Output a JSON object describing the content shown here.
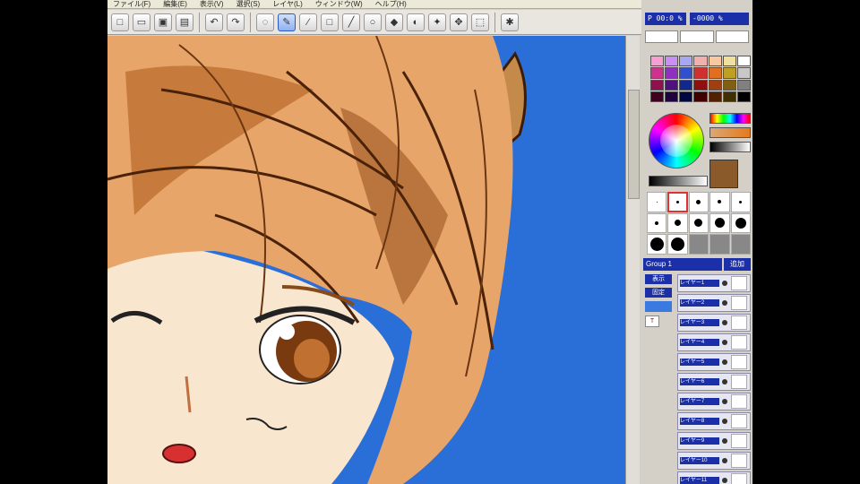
{
  "menubar": {
    "items": [
      "ファイル(F)",
      "編集(E)",
      "表示(V)",
      "選択(S)",
      "レイヤ(L)",
      "ウィンドウ(W)",
      "ヘルプ(H)"
    ]
  },
  "toolbar": {
    "tools": [
      {
        "name": "new-file-icon",
        "glyph": "□"
      },
      {
        "name": "open-folder-icon",
        "glyph": "▭"
      },
      {
        "name": "save-icon",
        "glyph": "▣"
      },
      {
        "name": "print-icon",
        "glyph": "▤"
      },
      {
        "name": "undo-icon",
        "glyph": "↶"
      },
      {
        "name": "redo-icon",
        "glyph": "↷"
      },
      {
        "name": "lasso-icon",
        "glyph": "◌"
      },
      {
        "name": "pen-icon",
        "glyph": "✎"
      },
      {
        "name": "eyedropper-icon",
        "glyph": "⁄"
      },
      {
        "name": "rectangle-icon",
        "glyph": "□"
      },
      {
        "name": "line-icon",
        "glyph": "╱"
      },
      {
        "name": "ellipse-icon",
        "glyph": "○"
      },
      {
        "name": "bucket-icon",
        "glyph": "◆"
      },
      {
        "name": "gradient-icon",
        "glyph": "◐"
      },
      {
        "name": "magic-wand-icon",
        "glyph": "✦"
      },
      {
        "name": "move-icon",
        "glyph": "✥"
      },
      {
        "name": "transform-icon",
        "glyph": "⬚"
      },
      {
        "name": "settings-icon",
        "glyph": "✱"
      }
    ]
  },
  "status": {
    "zoom": "P 00:0 %",
    "angle": "-0000 %"
  },
  "palette": {
    "colors": [
      "#f4a0d0",
      "#c890f0",
      "#a8a8f0",
      "#f0b0b0",
      "#f8c8a0",
      "#f0e0a0",
      "#ffffff",
      "#d03090",
      "#9030c0",
      "#3050d0",
      "#d03030",
      "#e07020",
      "#c0a020",
      "#c8c8c8",
      "#901050",
      "#501080",
      "#102890",
      "#901010",
      "#a04010",
      "#806010",
      "#808080",
      "#400020",
      "#200040",
      "#000840",
      "#400000",
      "#502000",
      "#403000",
      "#000000"
    ],
    "current_color": "#8a5a2a"
  },
  "brushes": {
    "sizes": [
      1,
      3,
      5,
      4,
      3,
      4,
      7,
      9,
      11,
      12,
      15,
      15,
      0,
      0,
      0
    ],
    "selected_index": 1
  },
  "layers": {
    "selector_label": "Group 1",
    "new_button": "追加",
    "tool_labels": [
      "表示",
      "固定",
      "",
      "T"
    ],
    "rows": [
      "レイヤー1",
      "レイヤー2",
      "レイヤー3",
      "レイヤー4",
      "レイヤー5",
      "レイヤー6",
      "レイヤー7",
      "レイヤー8",
      "レイヤー9",
      "レイヤー10",
      "レイヤー11"
    ]
  }
}
